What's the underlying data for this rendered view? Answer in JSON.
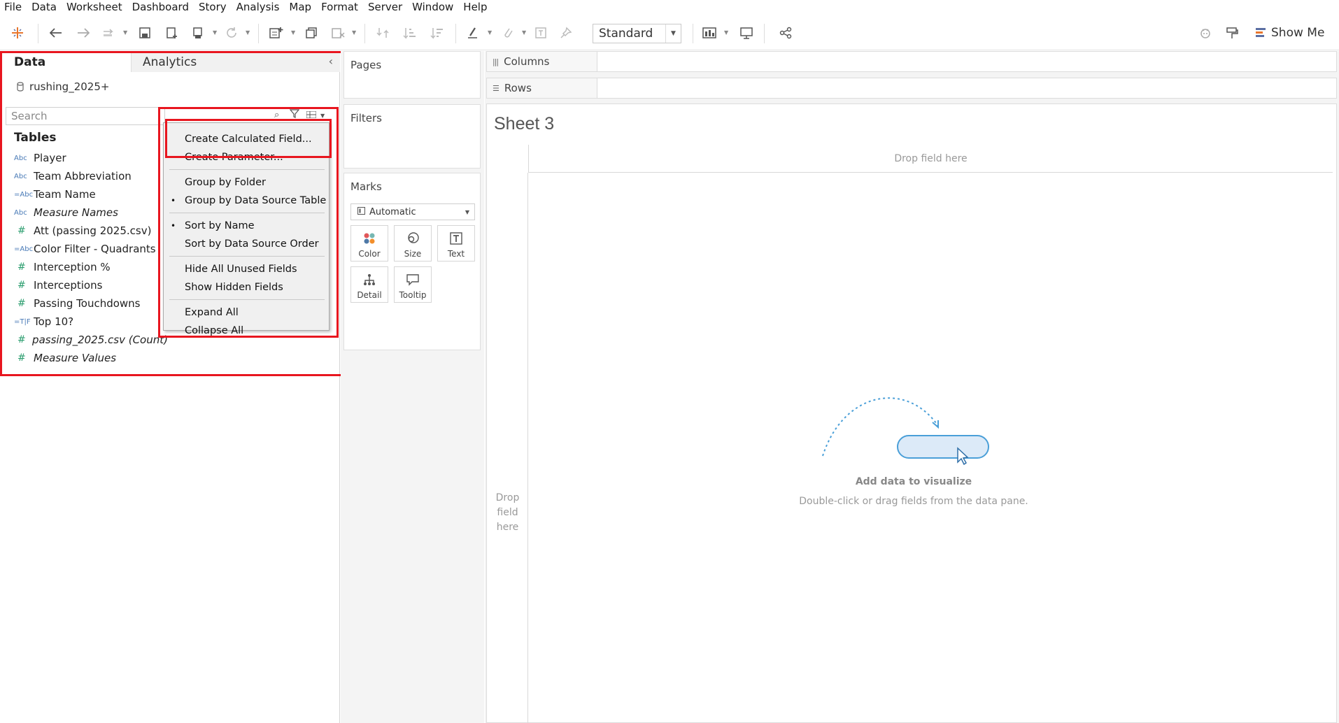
{
  "menu": [
    "File",
    "Data",
    "Worksheet",
    "Dashboard",
    "Story",
    "Analysis",
    "Map",
    "Format",
    "Server",
    "Window",
    "Help"
  ],
  "toolbar": {
    "fit_value": "Standard",
    "show_me_label": "Show Me"
  },
  "data_pane": {
    "tab_data": "Data",
    "tab_analytics": "Analytics",
    "datasource": "rushing_2025+",
    "search_placeholder": "Search",
    "tables_heading": "Tables",
    "fields": [
      {
        "type": "Abc",
        "label": "Player",
        "italic": false
      },
      {
        "type": "Abc",
        "label": "Team Abbreviation",
        "italic": false
      },
      {
        "type": "=Abc",
        "label": "Team Name",
        "italic": false
      },
      {
        "type": "Abc",
        "label": "Measure Names",
        "italic": true
      },
      {
        "type": "#",
        "label": "Att (passing 2025.csv)",
        "italic": false
      },
      {
        "type": "=Abc",
        "label": "Color Filter - Quadrants",
        "italic": false
      },
      {
        "type": "#",
        "label": "Interception %",
        "italic": false
      },
      {
        "type": "#",
        "label": "Interceptions",
        "italic": false
      },
      {
        "type": "#",
        "label": "Passing Touchdowns",
        "italic": false
      },
      {
        "type": "=T|F",
        "label": "Top 10?",
        "italic": false
      },
      {
        "type": "#",
        "label": "passing_2025.csv (Count)",
        "italic": true
      },
      {
        "type": "#",
        "label": "Measure Values",
        "italic": true
      }
    ]
  },
  "context_menu": {
    "items": [
      {
        "label": "Create Calculated Field...",
        "checked": false
      },
      {
        "label": "Create Parameter...",
        "checked": false
      },
      {
        "label": "Group by Folder",
        "checked": false
      },
      {
        "label": "Group by Data Source Table",
        "checked": true
      },
      {
        "label": "Sort by Name",
        "checked": true
      },
      {
        "label": "Sort by Data Source Order",
        "checked": false
      },
      {
        "label": "Hide All Unused Fields",
        "checked": false
      },
      {
        "label": "Show Hidden Fields",
        "checked": false
      },
      {
        "label": "Expand All",
        "checked": false
      },
      {
        "label": "Collapse All",
        "checked": false
      }
    ]
  },
  "cards": {
    "pages": "Pages",
    "filters": "Filters",
    "marks": "Marks",
    "marks_type": "Automatic",
    "mark_buttons": [
      "Color",
      "Size",
      "Text",
      "Detail",
      "Tooltip"
    ]
  },
  "shelves": {
    "columns": "Columns",
    "rows": "Rows"
  },
  "canvas": {
    "sheet_title": "Sheet 3",
    "drop_cols": "Drop field here",
    "drop_rows": "Drop field here",
    "hint_title": "Add data to visualize",
    "hint_sub": "Double-click or drag fields from the data pane."
  },
  "colors": {
    "highlight": "#e8161f",
    "dimension": "#4a7bb7",
    "measure": "#2c9e6f",
    "hint_blue": "#4a9fd8"
  }
}
